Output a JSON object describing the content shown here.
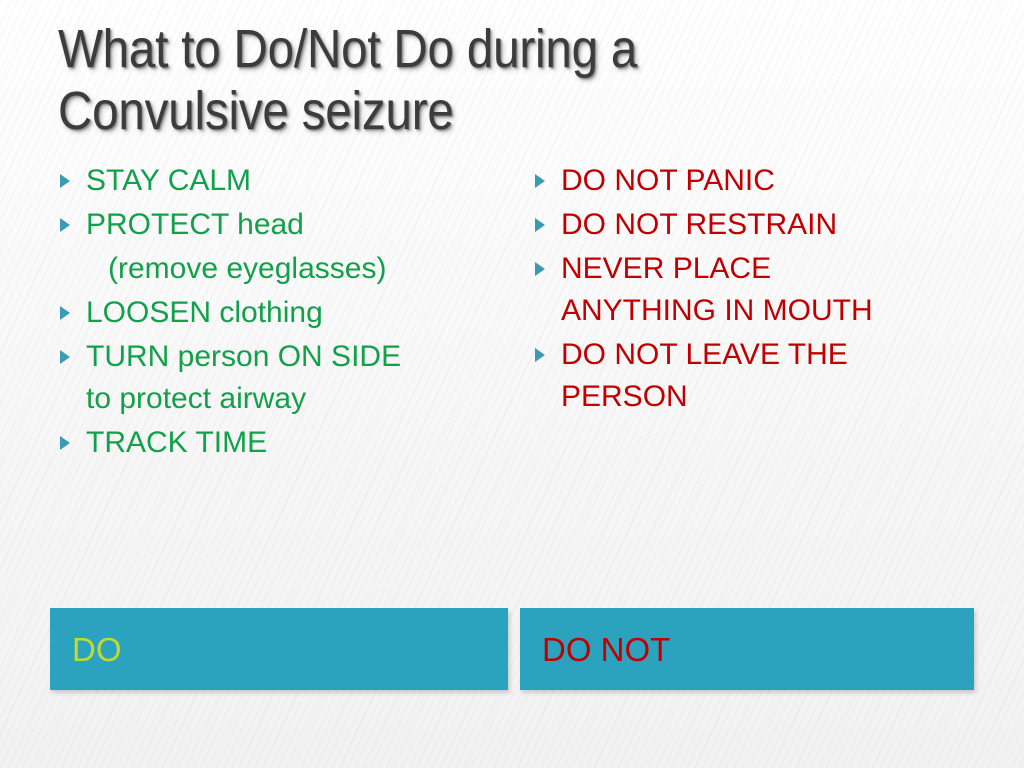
{
  "slide": {
    "title": "What to Do/Not Do during a\nConvulsive seizure",
    "background_color": "#fafafa",
    "title_color": "#3c3c3c"
  },
  "colors": {
    "do_green": "#12a04a",
    "dont_red": "#c00000",
    "bar_teal": "#2ba3bf",
    "bar_do_label": "#c3d92e",
    "bullet_marker": "#3a9bb5"
  },
  "columns": {
    "do": {
      "bullets": [
        {
          "text": "STAY CALM"
        },
        {
          "text": "PROTECT head"
        },
        {
          "text": "LOOSEN clothing"
        },
        {
          "text": "TURN person ON SIDE\nto protect airway"
        },
        {
          "text": "TRACK TIME"
        }
      ],
      "continuation_after_second": "(remove eyeglasses)"
    },
    "dont": {
      "bullets": [
        {
          "text": "DO NOT PANIC"
        },
        {
          "text": "DO NOT RESTRAIN"
        },
        {
          "text": "NEVER PLACE\nANYTHING IN MOUTH"
        },
        {
          "text": "DO NOT LEAVE THE\nPERSON"
        }
      ]
    }
  },
  "bars": {
    "do_label": "DO",
    "dont_label": "DO NOT"
  }
}
